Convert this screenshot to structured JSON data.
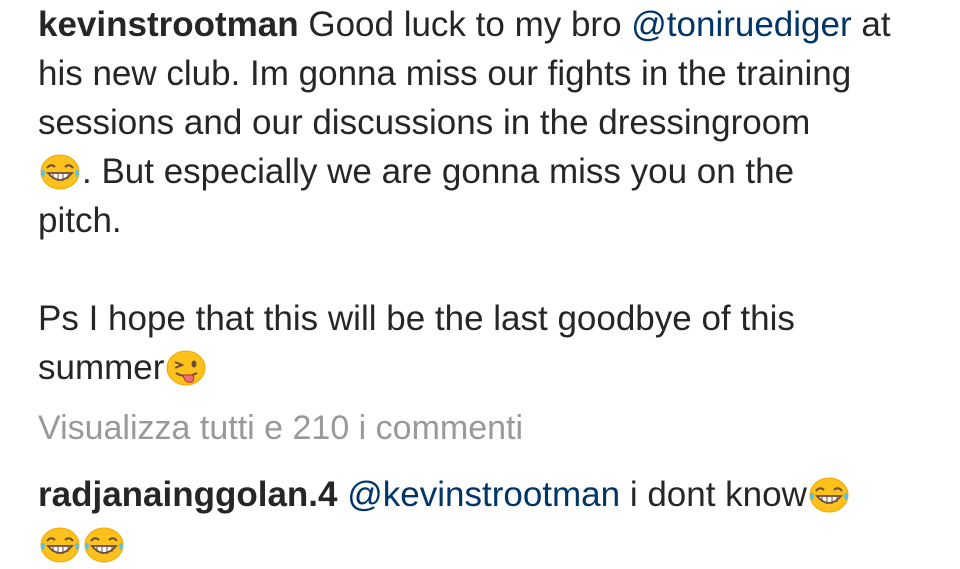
{
  "caption": {
    "username": "kevinstrootman",
    "line1_text": " Good luck to my bro ",
    "mention": "@toniruediger",
    "line1_after": " at",
    "line2": "his new club. Im gonna miss our fights in the training",
    "line3": "sessions  and our discussions in the dressingroom",
    "line4_after": ". But especially we are gonna miss you on the",
    "line5": "pitch.",
    "line6": "Ps I hope that this will be the last goodbye of this",
    "line7": "summer",
    "emoji_laugh": "face-with-tears-of-joy-icon",
    "emoji_wink": "winking-face-with-tongue-icon"
  },
  "view_all_comments": "Visualizza tutti e 210 i commenti",
  "comment": {
    "username": "radjanainggolan.4",
    "mention": "@kevinstrootman",
    "text": " i dont know"
  },
  "colors": {
    "text": "#262626",
    "mention": "#003569",
    "muted": "#999999",
    "emoji_yellow": "#FCC21B"
  }
}
